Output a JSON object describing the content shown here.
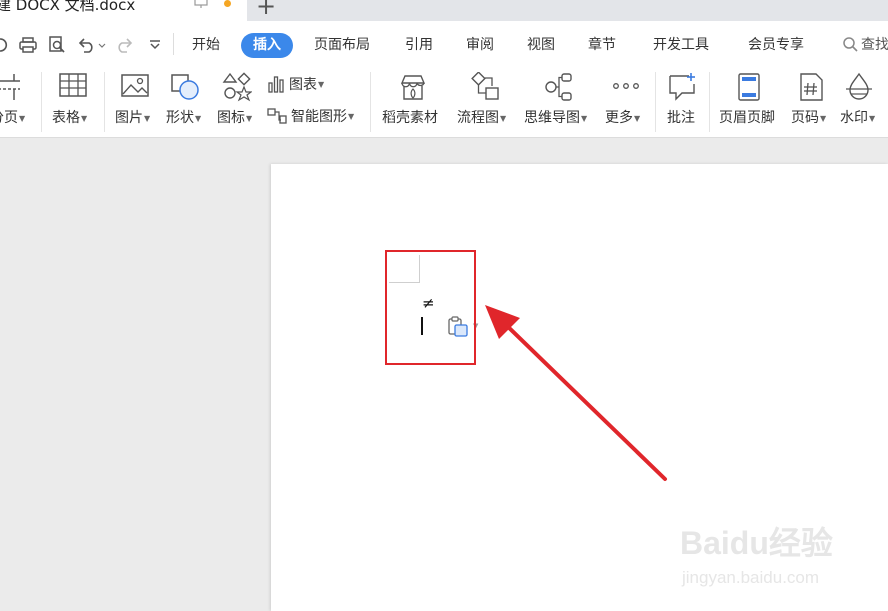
{
  "tab": {
    "title": "建 DOCX 文档.docx"
  },
  "menu": {
    "items": [
      "开始",
      "插入",
      "页面布局",
      "引用",
      "审阅",
      "视图",
      "章节",
      "开发工具",
      "会员专享"
    ],
    "active": "插入",
    "search_label": "查找"
  },
  "ribbon": {
    "page_break": "分页",
    "table": "表格",
    "picture": "图片",
    "shape": "形状",
    "icon": "图标",
    "chart": "图表",
    "smart_art": "智能图形",
    "docer_material": "稻壳素材",
    "flowchart": "流程图",
    "mind_map": "思维导图",
    "more": "更多",
    "comment": "批注",
    "header_footer": "页眉页脚",
    "page_number": "页码",
    "watermark": "水印"
  },
  "document": {
    "symbol": "≠"
  },
  "watermark": {
    "brand": "Baidu经验",
    "url": "jingyan.baidu.com"
  },
  "colors": {
    "accent": "#3b88ea",
    "highlight": "#e0262b",
    "tab_dot": "#f5a623"
  }
}
